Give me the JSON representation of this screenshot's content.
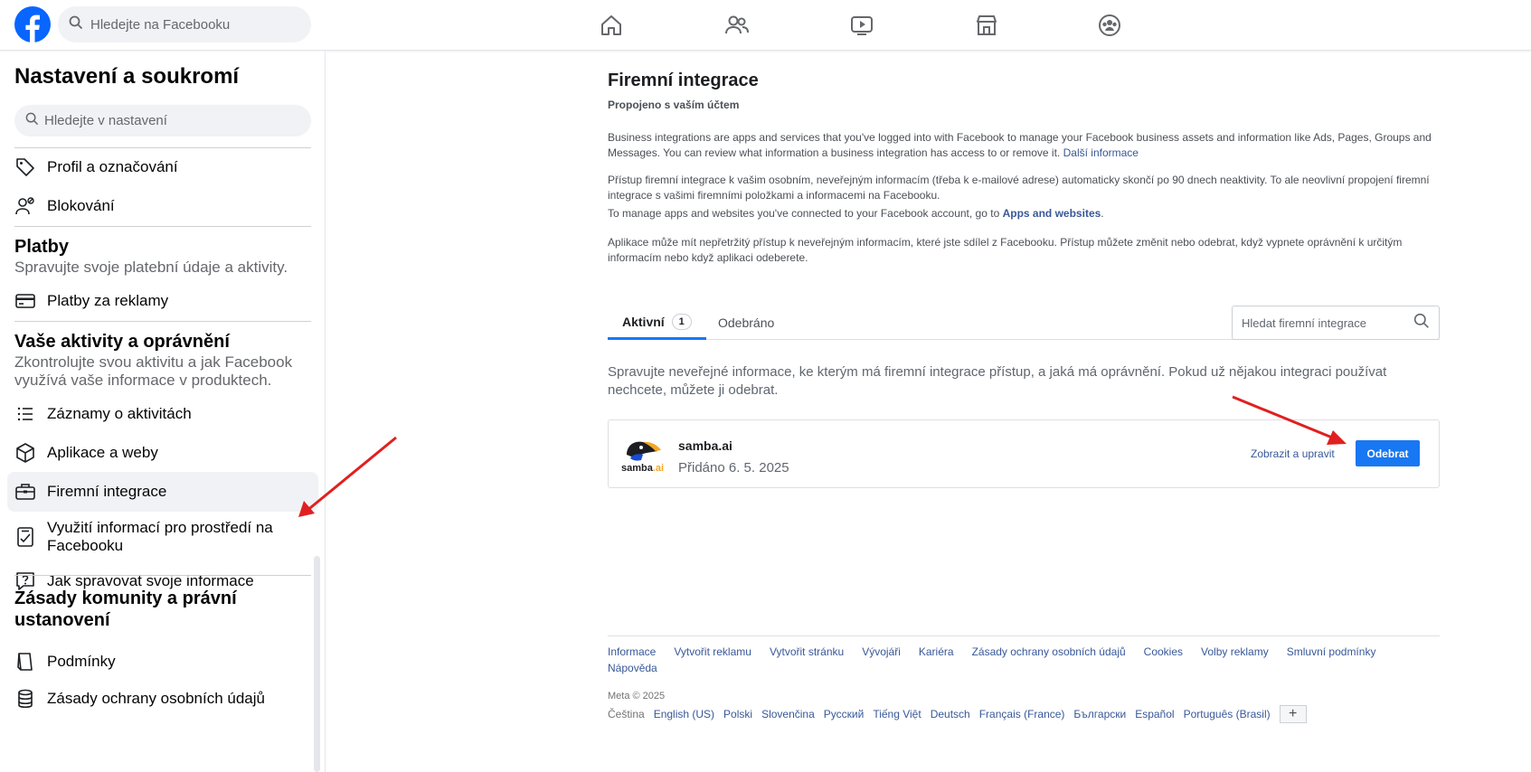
{
  "topbar": {
    "search_placeholder": "Hledejte na Facebooku",
    "nav_icons": [
      "home-icon",
      "friends-icon",
      "video-icon",
      "marketplace-icon",
      "groups-icon"
    ]
  },
  "sidebar": {
    "title": "Nastavení a soukromí",
    "search_placeholder": "Hledejte v nastavení",
    "items_top": [
      {
        "label": "Profil a označování",
        "icon": "tag-icon"
      },
      {
        "label": "Blokování",
        "icon": "block-user-icon"
      }
    ],
    "payments": {
      "heading": "Platby",
      "desc": "Spravujte svoje platební údaje a aktivity.",
      "items": [
        {
          "label": "Platby za reklamy",
          "icon": "card-icon"
        }
      ]
    },
    "activity": {
      "heading": "Vaše aktivity a oprávnění",
      "desc": "Zkontrolujte svou aktivitu a jak Facebook využívá vaše informace v produktech.",
      "items": [
        {
          "label": "Záznamy o aktivitách",
          "icon": "list-icon"
        },
        {
          "label": "Aplikace a weby",
          "icon": "cube-icon"
        },
        {
          "label": "Firemní integrace",
          "icon": "briefcase-icon"
        },
        {
          "label": "Využití informací pro prostředí na Facebooku",
          "icon": "checklist-icon"
        },
        {
          "label": "Jak spravovat svoje informace",
          "icon": "question-icon"
        }
      ]
    },
    "community": {
      "heading": "Zásady komunity a právní ustanovení",
      "items": [
        {
          "label": "Podmínky",
          "icon": "book-icon"
        },
        {
          "label": "Zásady ochrany osobních údajů",
          "icon": "database-icon"
        }
      ]
    }
  },
  "main": {
    "title": "Firemní integrace",
    "subtitle": "Propojeno s vaším účtem",
    "para1": "Business integrations are apps and services that you've logged into with Facebook to manage your Facebook business assets and information like Ads, Pages, Groups and Messages. You can review what information a business integration has access to or remove it.",
    "para1_link": "Další informace",
    "para2": "Přístup firemní integrace k vašim osobním, neveřejným informacím (třeba k e-mailové adrese) automaticky skončí po 90 dnech neaktivity. To ale neovlivní propojení firemní integrace s vašimi firemními položkami a informacemi na Facebooku.",
    "para3_pre": "To manage apps and websites you've connected to your Facebook account, go to",
    "para3_link": "Apps and websites",
    "para3_post": ".",
    "para4": "Aplikace může mít nepřetržitý přístup k neveřejným informacím, které jste sdílel z Facebooku. Přístup můžete změnit nebo odebrat, když vypnete oprávnění k určitým informacím nebo když aplikaci odeberete.",
    "tabs": {
      "active_label": "Aktivní",
      "active_count": "1",
      "removed_label": "Odebráno"
    },
    "integration_search_placeholder": "Hledat firemní integrace",
    "help_text": "Spravujte neveřejné informace, ke kterým má firemní integrace přístup, a jaká má oprávnění. Pokud už nějakou integraci používat nechcete, můžete ji odebrat.",
    "integration": {
      "name": "samba.ai",
      "logo_text": "samba",
      "logo_suffix": ".ai",
      "added": "Přidáno 6. 5. 2025",
      "edit_label": "Zobrazit a upravit",
      "remove_label": "Odebrat"
    }
  },
  "footer": {
    "links": [
      "Informace",
      "Vytvořit reklamu",
      "Vytvořit stránku",
      "Vývojáři",
      "Kariéra",
      "Zásady ochrany osobních údajů",
      "Cookies",
      "Volby reklamy",
      "Smluvní podmínky",
      "Nápověda"
    ],
    "copyright": "Meta © 2025",
    "current_language": "Čeština",
    "languages": [
      "English (US)",
      "Polski",
      "Slovenčina",
      "Русский",
      "Tiếng Việt",
      "Deutsch",
      "Français (France)",
      "Български",
      "Español",
      "Português (Brasil)"
    ],
    "more_label": "+"
  },
  "colors": {
    "brand": "#0866ff",
    "button": "#1877f2",
    "link": "#385898",
    "annotation_arrow": "#e02020"
  }
}
